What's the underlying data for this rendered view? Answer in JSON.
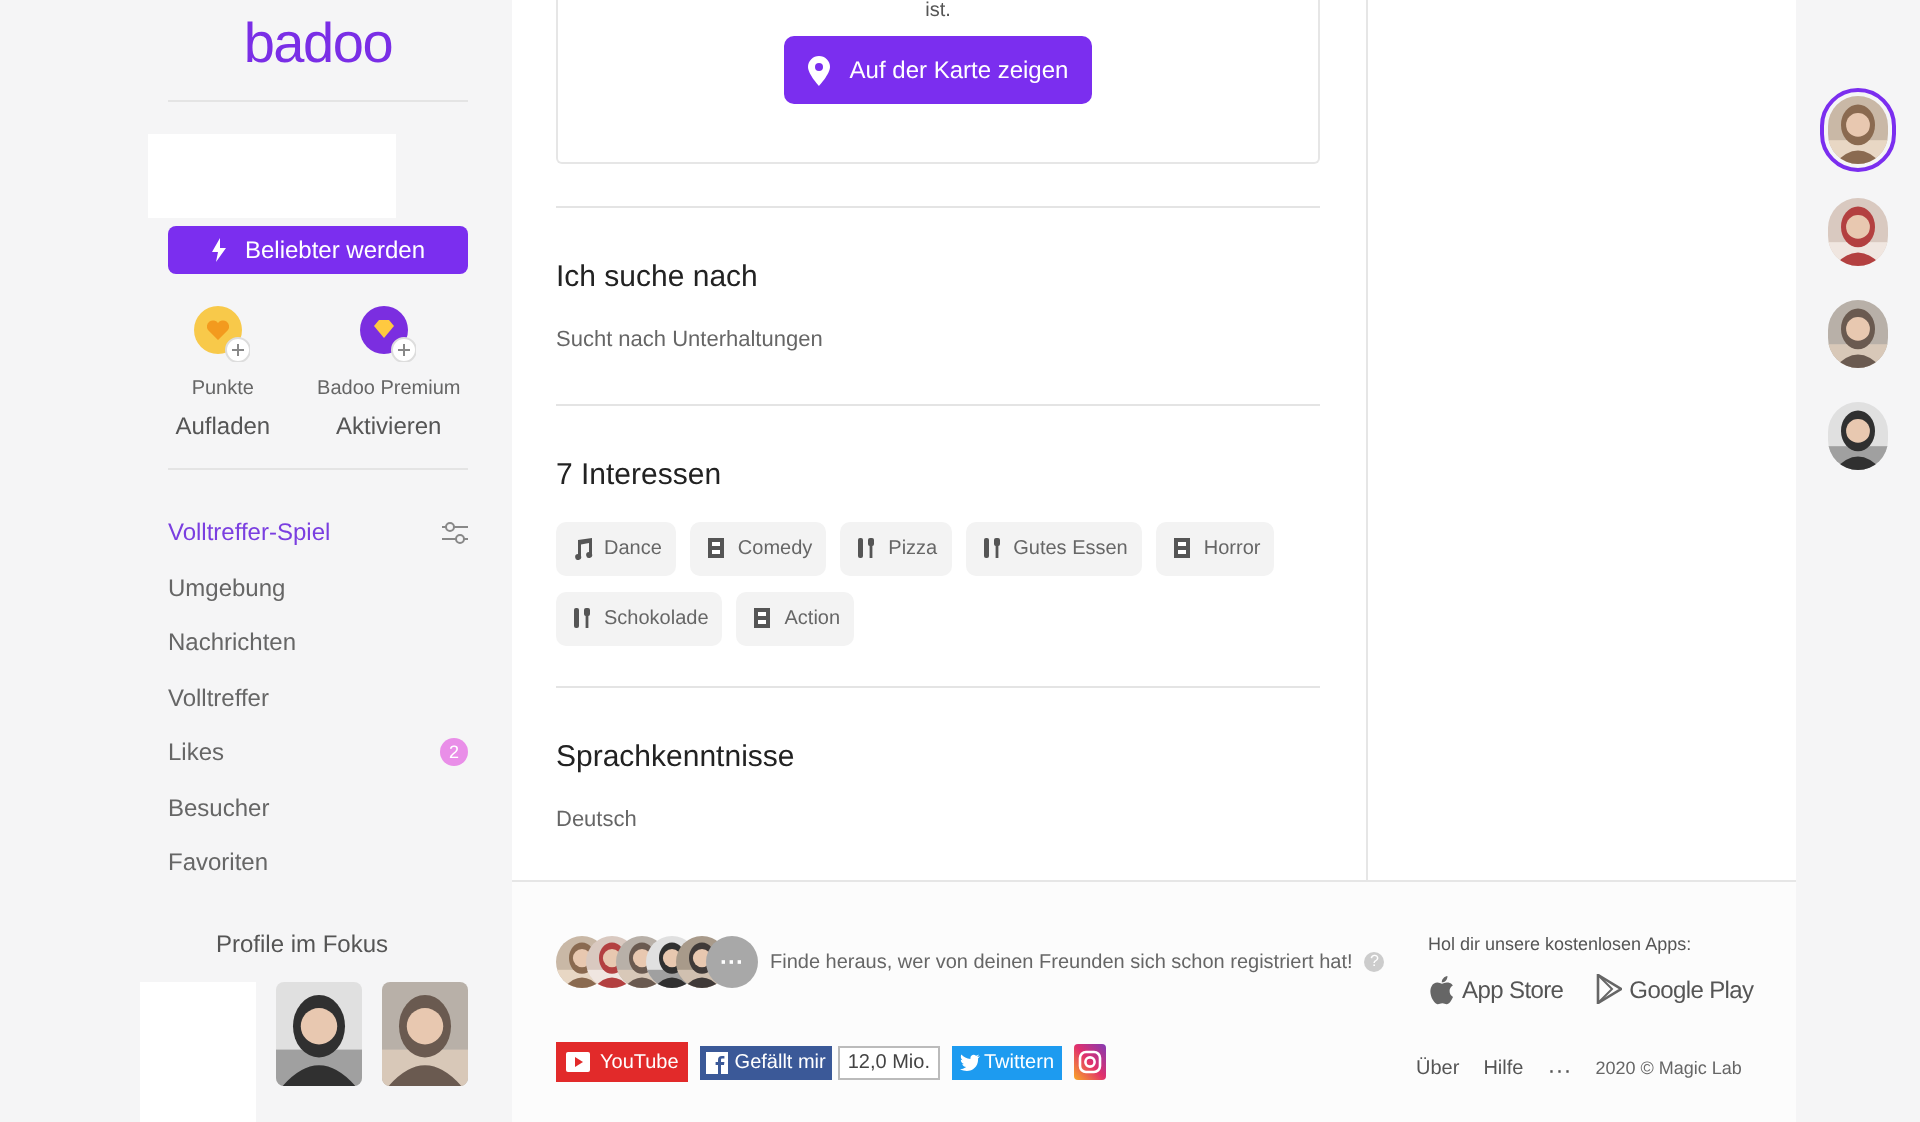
{
  "logo": "badoo",
  "sidebar": {
    "boost_button": "Beliebter werden",
    "wallet": [
      {
        "kind": "points",
        "title": "Punkte",
        "action": "Aufladen"
      },
      {
        "kind": "premium",
        "title": "Badoo Premium",
        "action": "Aktivieren"
      }
    ],
    "nav": [
      {
        "label": "Volltreffer-Spiel",
        "selected": true,
        "filter": true
      },
      {
        "label": "Umgebung",
        "selected": false
      },
      {
        "label": "Nachrichten",
        "selected": false
      },
      {
        "label": "Volltreffer",
        "selected": false
      },
      {
        "label": "Likes",
        "selected": false,
        "badge": "2"
      },
      {
        "label": "Besucher",
        "selected": false
      },
      {
        "label": "Favoriten",
        "selected": false
      }
    ],
    "spotlight_title": "Profile im Fokus"
  },
  "location_card": {
    "text_tail": "ist.",
    "button": "Auf der Karte zeigen"
  },
  "sections": [
    {
      "kind": "text",
      "title": "Ich suche nach",
      "text": "Sucht nach Unterhaltungen"
    },
    {
      "kind": "chips",
      "title": "7 Interessen",
      "chips": [
        {
          "kind": "music",
          "label": "Dance"
        },
        {
          "kind": "film",
          "label": "Comedy"
        },
        {
          "kind": "food",
          "label": "Pizza"
        },
        {
          "kind": "food",
          "label": "Gutes Essen"
        },
        {
          "kind": "film",
          "label": "Horror"
        },
        {
          "kind": "food",
          "label": "Schokolade"
        },
        {
          "kind": "film",
          "label": "Action"
        }
      ]
    },
    {
      "kind": "text",
      "title": "Sprachkenntnisse",
      "text": "Deutsch"
    }
  ],
  "footer": {
    "friends_text": "Finde heraus, wer von deinen Freunden sich schon registriert hat!",
    "more_friends": "···",
    "help_mark": "?",
    "apps_title": "Hol dir unsere kostenlosen Apps:",
    "app_store": "App Store",
    "google_play": "Google Play",
    "youtube": "YouTube",
    "facebook_like": "Gefällt mir",
    "facebook_count": "12,0 Mio.",
    "twitter": "Twittern",
    "links": [
      "Über",
      "Hilfe"
    ],
    "more_links": "···",
    "copyright": "2020 © Magic Lab"
  },
  "rail": [
    {
      "selected": true
    },
    {
      "selected": false
    },
    {
      "selected": false
    },
    {
      "selected": false
    }
  ]
}
